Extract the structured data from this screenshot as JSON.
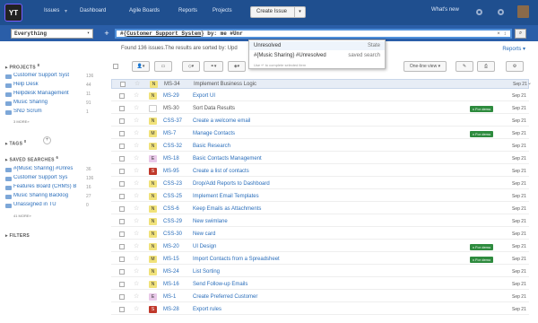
{
  "topbar": {
    "logo_text": "YT",
    "nav": [
      "Issues",
      "Dashboard",
      "Agile Boards",
      "Reports",
      "Projects"
    ],
    "issues_arrow": "▾",
    "create_label": "Create Issue",
    "create_arrow": "▾",
    "whats_new": "What's new"
  },
  "search": {
    "context": "Everything",
    "context_arrow": "▾",
    "plus": "+",
    "query_prefix": "#{",
    "query_project": "Customer Support System",
    "query_suffix": "} by: me #Unr",
    "query_controls": "× ↕",
    "search_icon": "⌕"
  },
  "results": {
    "found_text": "Found 136 issues.The results are sorted by: Upd",
    "reports_label": "Reports ▾"
  },
  "suggest": {
    "rows": [
      {
        "label": "Unresolved",
        "bold_part": "Unr",
        "kind": "State"
      },
      {
        "label": "#{Music Sharing} #Unresolved",
        "kind": "saved search"
      }
    ],
    "hint": "Use ↵ to complete selected item"
  },
  "sidebar": {
    "projects_header": "PROJECTS",
    "projects_sup": "8",
    "projects": [
      {
        "name": "Customer Support Syst",
        "count": "136"
      },
      {
        "name": "Help Desk",
        "count": "44"
      },
      {
        "name": "Helpdesk Management",
        "count": "11"
      },
      {
        "name": "Music Sharing",
        "count": "91"
      },
      {
        "name": "SND Scrum",
        "count": "1"
      }
    ],
    "projects_more": "3 MORE»",
    "tags_header": "TAGS",
    "tags_sup": "0",
    "tags_add": "+",
    "saved_header": "SAVED SEARCHES",
    "saved_sup": "6",
    "saved": [
      {
        "name": "#{Music Sharing} #Unres",
        "count": "36"
      },
      {
        "name": "Customer Support Sys",
        "count": "136"
      },
      {
        "name": "Features Board (CRMS) Ba",
        "count": "16"
      },
      {
        "name": "Music Sharing Backlog",
        "count": "27"
      },
      {
        "name": "Unassigned in TU",
        "count": "0"
      }
    ],
    "saved_more": "41 MORE»",
    "filters_header": "FILTERS"
  },
  "toolbar": {
    "view_label": "One-line view ▾"
  },
  "issues": [
    {
      "id": "MS-34",
      "summary": "Implement Business Logic",
      "date": "Sep 21",
      "pri": "N",
      "pri_color": "#f1e27a",
      "tag": "",
      "selected": true,
      "muted": true
    },
    {
      "id": "MS-29",
      "summary": "Export UI",
      "date": "Sep 21",
      "pri": "N",
      "pri_color": "#f1e27a",
      "tag": ""
    },
    {
      "id": "MS-30",
      "summary": "Sort Data Results",
      "date": "Sep 21",
      "pri": "",
      "pri_color": "#ffffff",
      "tag": "x For demo",
      "muted": true
    },
    {
      "id": "CSS-37",
      "summary": "Create a welcome email",
      "date": "Sep 21",
      "pri": "N",
      "pri_color": "#f1e27a",
      "tag": ""
    },
    {
      "id": "MS-7",
      "summary": "Manage Contacts",
      "date": "Sep 21",
      "pri": "M",
      "pri_color": "#f1e27a",
      "tag": "x For demo"
    },
    {
      "id": "CSS-32",
      "summary": "Basic Research",
      "date": "Sep 21",
      "pri": "N",
      "pri_color": "#f1e27a",
      "tag": ""
    },
    {
      "id": "MS-18",
      "summary": "Basic Contacts Management",
      "date": "Sep 21",
      "pri": "E",
      "pri_color": "#e9c9e9",
      "tag": ""
    },
    {
      "id": "MS-95",
      "summary": "Create a list of contacts",
      "date": "Sep 21",
      "pri": "S",
      "pri_color": "#c0392b",
      "tag": ""
    },
    {
      "id": "CSS-23",
      "summary": "Drop/Add Reports to Dashboard",
      "date": "Sep 21",
      "pri": "N",
      "pri_color": "#f1e27a",
      "tag": ""
    },
    {
      "id": "CSS-25",
      "summary": "Implement Email Templates",
      "date": "Sep 21",
      "pri": "N",
      "pri_color": "#f1e27a",
      "tag": ""
    },
    {
      "id": "CSS-6",
      "summary": "Keep Emails as Attachments",
      "date": "Sep 21",
      "pri": "N",
      "pri_color": "#f1e27a",
      "tag": ""
    },
    {
      "id": "CSS-29",
      "summary": "New swimlane",
      "date": "Sep 21",
      "pri": "N",
      "pri_color": "#f1e27a",
      "tag": ""
    },
    {
      "id": "CSS-30",
      "summary": "New card",
      "date": "Sep 21",
      "pri": "N",
      "pri_color": "#f1e27a",
      "tag": ""
    },
    {
      "id": "MS-20",
      "summary": "UI Design",
      "date": "Sep 21",
      "pri": "N",
      "pri_color": "#f1e27a",
      "tag": "x For demo"
    },
    {
      "id": "MS-15",
      "summary": "Import Contacts from a Spreadsheet",
      "date": "Sep 21",
      "pri": "M",
      "pri_color": "#f1e27a",
      "tag": "x For demo"
    },
    {
      "id": "MS-24",
      "summary": "List Sorting",
      "date": "Sep 21",
      "pri": "N",
      "pri_color": "#f1e27a",
      "tag": ""
    },
    {
      "id": "MS-16",
      "summary": "Send Follow-up Emails",
      "date": "Sep 21",
      "pri": "N",
      "pri_color": "#f1e27a",
      "tag": ""
    },
    {
      "id": "MS-1",
      "summary": "Create Preferred Customer",
      "date": "Sep 21",
      "pri": "E",
      "pri_color": "#e9c9e9",
      "tag": ""
    },
    {
      "id": "MS-28",
      "summary": "Export rules",
      "date": "Sep 21",
      "pri": "S",
      "pri_color": "#c0392b",
      "tag": ""
    }
  ]
}
